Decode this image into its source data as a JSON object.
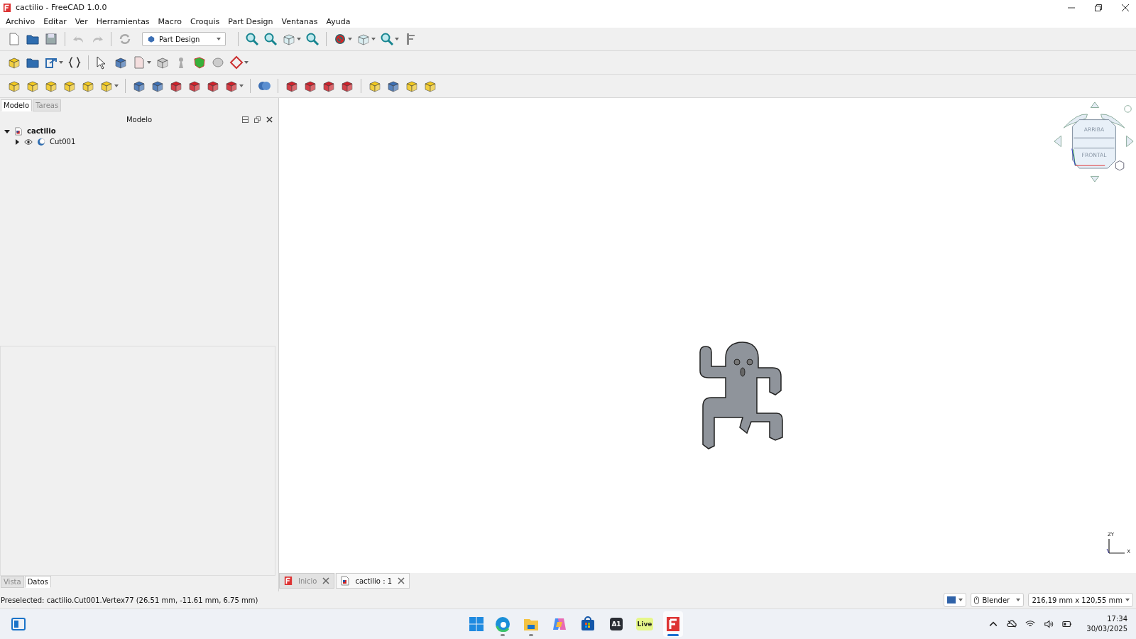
{
  "window": {
    "title": "cactilio - FreeCAD 1.0.0"
  },
  "menu": [
    "Archivo",
    "Editar",
    "Ver",
    "Herramientas",
    "Macro",
    "Croquis",
    "Part Design",
    "Ventanas",
    "Ayuda"
  ],
  "workbench": {
    "value": "Part Design"
  },
  "panel_tabs": [
    {
      "label": "Modelo",
      "selected": true
    },
    {
      "label": "Tareas",
      "selected": false
    }
  ],
  "panel": {
    "title": "Modelo"
  },
  "tree": [
    {
      "label": "cactilio",
      "expanded": true,
      "children": [
        {
          "label": "Cut001",
          "expanded": false,
          "visible": true
        }
      ]
    }
  ],
  "property_tabs": [
    {
      "label": "Vista",
      "selected": false
    },
    {
      "label": "Datos",
      "selected": true
    }
  ],
  "nav_cube": {
    "top": "ARRIBA",
    "front": "FRONTAL"
  },
  "axes": {
    "z": "Z",
    "y": "Y",
    "x": "X"
  },
  "document_tabs": [
    {
      "label": "Inicio",
      "kind": "start",
      "selected": false
    },
    {
      "label": "cactilio : 1",
      "kind": "document",
      "selected": true
    }
  ],
  "status_bar": {
    "message": "Preselected: cactilio.Cut001.Vertex77 (26.51 mm, -11.61 mm, 6.75 mm)",
    "navigation": "Blender",
    "dimensions": "216,19 mm x 120,55 mm"
  },
  "taskbar": {
    "apps": [
      {
        "kind": "edge",
        "running": true
      },
      {
        "kind": "explorer",
        "running": true
      },
      {
        "kind": "copilot",
        "running": false
      },
      {
        "kind": "store",
        "running": false
      },
      {
        "kind": "tile",
        "label": "A1",
        "running": false
      },
      {
        "kind": "live",
        "label": "Live",
        "running": false
      },
      {
        "kind": "freecad",
        "running": true,
        "selected": true
      }
    ],
    "clock": {
      "time": "17:34",
      "date": "30/03/2025"
    }
  }
}
